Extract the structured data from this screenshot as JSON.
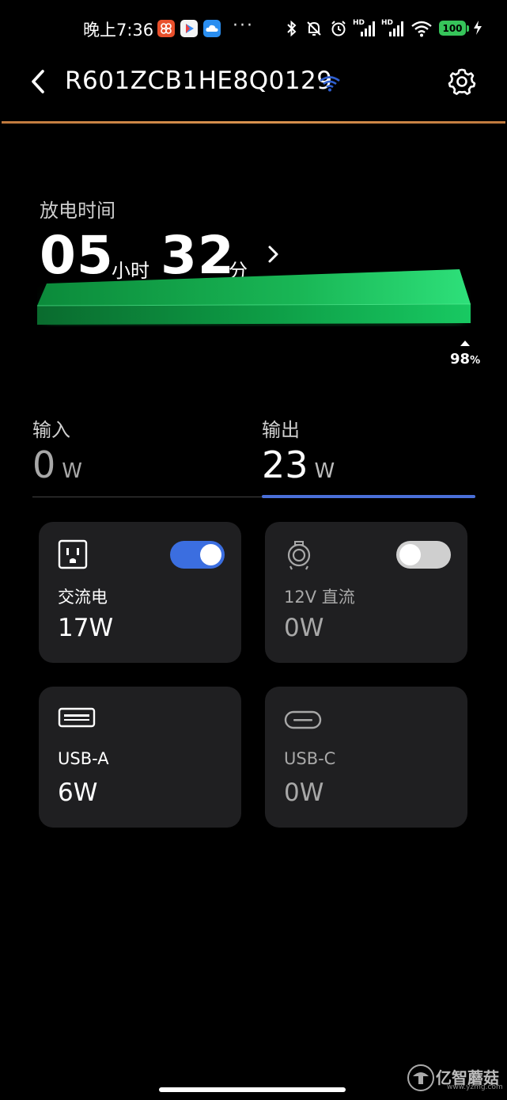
{
  "status_bar": {
    "time": "晚上7:36",
    "battery": "100",
    "signal_label_1": "HD",
    "signal_label_2": "HD",
    "dots": "···"
  },
  "header": {
    "title": "R601ZCB1HE8Q0129"
  },
  "discharge": {
    "label": "放电时间",
    "hours": "05",
    "hours_unit": "小时",
    "minutes": "32",
    "minutes_unit": "分",
    "percent": "98",
    "percent_unit": "%"
  },
  "io": {
    "input_label": "输入",
    "input_value": "0",
    "input_unit": "W",
    "output_label": "输出",
    "output_value": "23",
    "output_unit": "W",
    "active_tab": "output"
  },
  "ports": [
    {
      "name": "交流电",
      "value": "17W",
      "icon": "ac-outlet-icon",
      "toggle": true
    },
    {
      "name": "12V 直流",
      "value": "0W",
      "icon": "dc-12v-icon",
      "toggle": false
    },
    {
      "name": "USB-A",
      "value": "6W",
      "icon": "usb-a-icon"
    },
    {
      "name": "USB-C",
      "value": "0W",
      "icon": "usb-c-icon"
    }
  ],
  "watermark": {
    "text": "亿智蘑菇",
    "url": "www.yzmg.com"
  },
  "colors": {
    "accent": "#3b6ee0",
    "battery_green": "#00d05a",
    "header_rule": "#d9924e",
    "card_bg": "#1f1f21"
  }
}
